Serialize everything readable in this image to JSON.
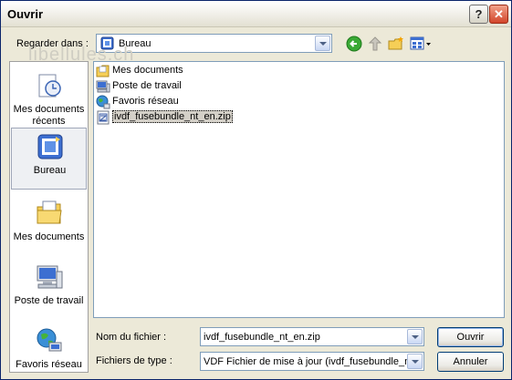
{
  "window": {
    "title": "Ouvrir",
    "help_label": "?",
    "close_label": "✕"
  },
  "lookin": {
    "label": "Regarder dans :",
    "value": "Bureau"
  },
  "watermark": "libellules.ch",
  "places": [
    {
      "label_line1": "Mes documents",
      "label_line2": "récents",
      "icon": "recent-documents-icon"
    },
    {
      "label_line1": "Bureau",
      "label_line2": "",
      "icon": "desktop-icon"
    },
    {
      "label_line1": "Mes documents",
      "label_line2": "",
      "icon": "my-documents-folder-icon"
    },
    {
      "label_line1": "Poste de travail",
      "label_line2": "",
      "icon": "my-computer-icon"
    },
    {
      "label_line1": "Favoris réseau",
      "label_line2": "",
      "icon": "network-places-icon"
    }
  ],
  "files": [
    {
      "name": "Mes documents",
      "icon": "folder-icon"
    },
    {
      "name": "Poste de travail",
      "icon": "computer-icon"
    },
    {
      "name": "Favoris réseau",
      "icon": "network-icon"
    },
    {
      "name": "ivdf_fusebundle_nt_en.zip",
      "icon": "zip-file-icon",
      "selected": true
    }
  ],
  "filename": {
    "label": "Nom du fichier :",
    "value": "ivdf_fusebundle_nt_en.zip"
  },
  "filetype": {
    "label": "Fichiers de type :",
    "value": "VDF Fichier de mise à jour (ivdf_fusebundle_nt_en.zip)"
  },
  "buttons": {
    "open": "Ouvrir",
    "cancel": "Annuler"
  },
  "colors": {
    "dialog_bg": "#ece9d8",
    "border_blue": "#7f9db9",
    "close_red": "#d2452b"
  }
}
